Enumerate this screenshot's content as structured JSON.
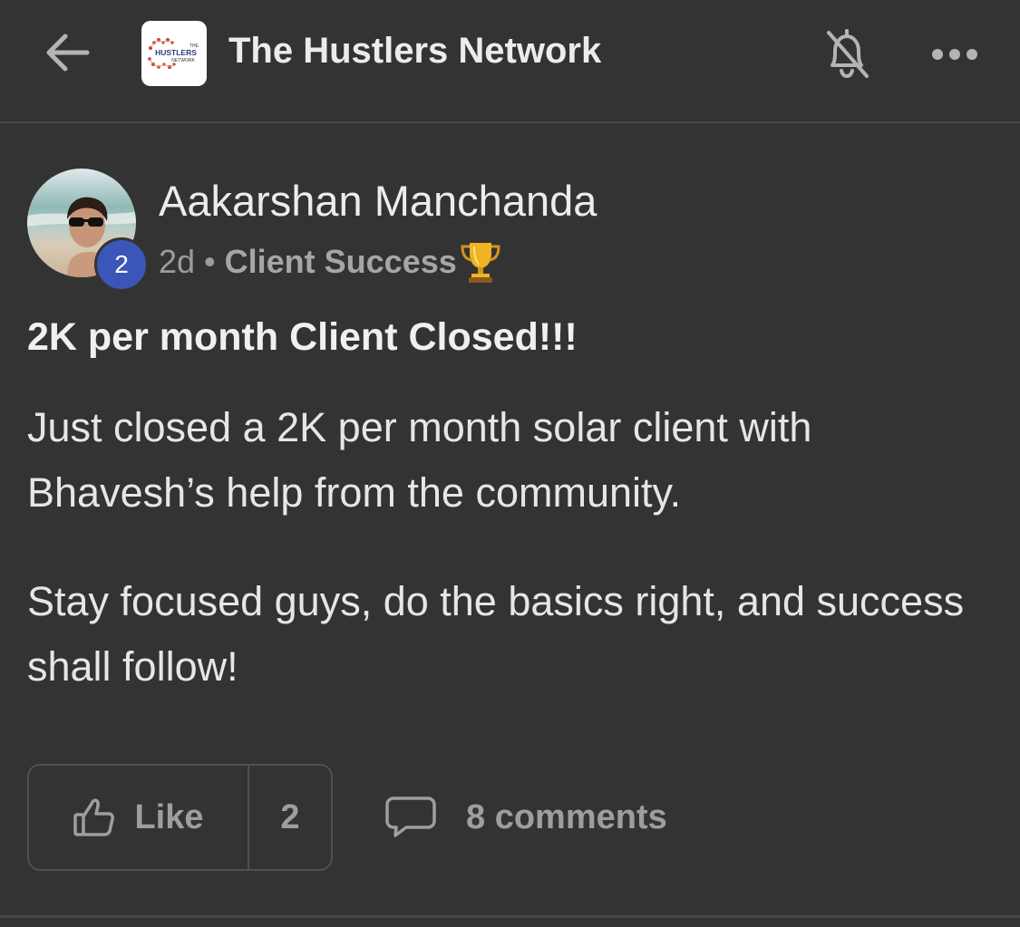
{
  "header": {
    "title": "The Hustlers Network",
    "logo_text": [
      "THE",
      "HUSTLERS",
      "NETWORK"
    ],
    "icons": {
      "back": "back-arrow-icon",
      "bell": "bell-off-icon",
      "more": "more-horizontal-icon"
    }
  },
  "post": {
    "author": "Aakarshan Manchanda",
    "level": "2",
    "time": "2d",
    "separator": "•",
    "category": "Client Success",
    "category_icon": "trophy-icon",
    "title": "2K per month Client Closed!!!",
    "body": [
      "Just closed a 2K per month solar client with Bhavesh’s help from the community.",
      "Stay focused guys, do the basics right, and success shall follow!"
    ],
    "like_label": "Like",
    "like_count": "2",
    "comments_label": "8 comments"
  },
  "colors": {
    "background": "#333333",
    "divider": "#474747",
    "level_badge": "#3a56b8",
    "muted_text": "#9e9e9e"
  }
}
